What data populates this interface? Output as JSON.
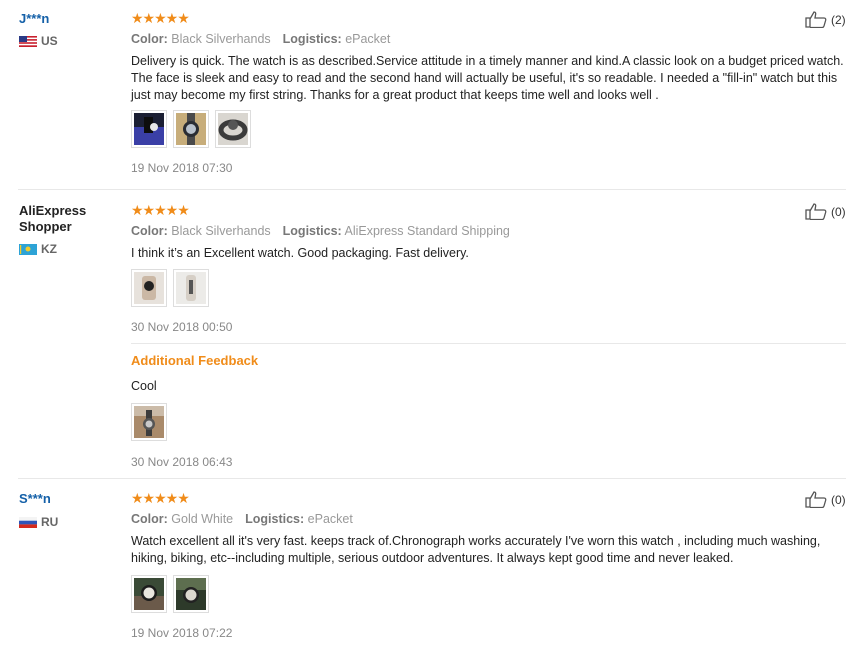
{
  "reviews": [
    {
      "user": "J***n",
      "country": "US",
      "stars": "★★★★★",
      "color_label": "Color:",
      "color_value": "Black Silverhands",
      "logistics_label": "Logistics:",
      "logistics_value": "ePacket",
      "text": "Delivery is quick. The watch is as described.Service attitude in a timely manner and kind.A classic look on a budget priced watch. The face is sleek and easy to read and the second hand will actually be useful, it's so readable. I needed a \"fill-in\" watch but this just may become my first string. Thanks for a great product that keeps time well and looks well .",
      "date": "19 Nov 2018 07:30",
      "helpful": "(2)",
      "images": [
        "watch-box-photo",
        "watch-face-photo",
        "watch-band-photo"
      ]
    },
    {
      "user": "AliExpress Shopper",
      "country": "KZ",
      "stars": "★★★★★",
      "color_label": "Color:",
      "color_value": "Black Silverhands",
      "logistics_label": "Logistics:",
      "logistics_value": "AliExpress Standard Shipping",
      "text": "I think it’s an Excellent watch. Good packaging. Fast delivery.",
      "date": "30 Nov 2018 00:50",
      "helpful": "(0)",
      "images": [
        "watch-on-hand-photo",
        "watch-side-photo"
      ],
      "additional": {
        "title": "Additional Feedback",
        "text": "Cool",
        "date": "30 Nov 2018 06:43",
        "images": [
          "watch-on-table-photo"
        ]
      }
    },
    {
      "user": "S***n",
      "country": "RU",
      "stars": "★★★★★",
      "color_label": "Color:",
      "color_value": "Gold White",
      "logistics_label": "Logistics:",
      "logistics_value": "ePacket",
      "text": "Watch excellent all it's very fast. keeps track of.Chronograph works accurately I've worn this watch , including much washing, hiking, biking, etc--including multiple, serious outdoor adventures. It always kept good time and never leaked.",
      "date": "19 Nov 2018 07:22",
      "helpful": "(0)",
      "images": [
        "watch-wrist-photo",
        "watch-wrist-photo-2"
      ]
    }
  ],
  "colors": {
    "star": "#f08c1a",
    "masked_name": "#1460a8",
    "accent": "#f08c1a"
  }
}
